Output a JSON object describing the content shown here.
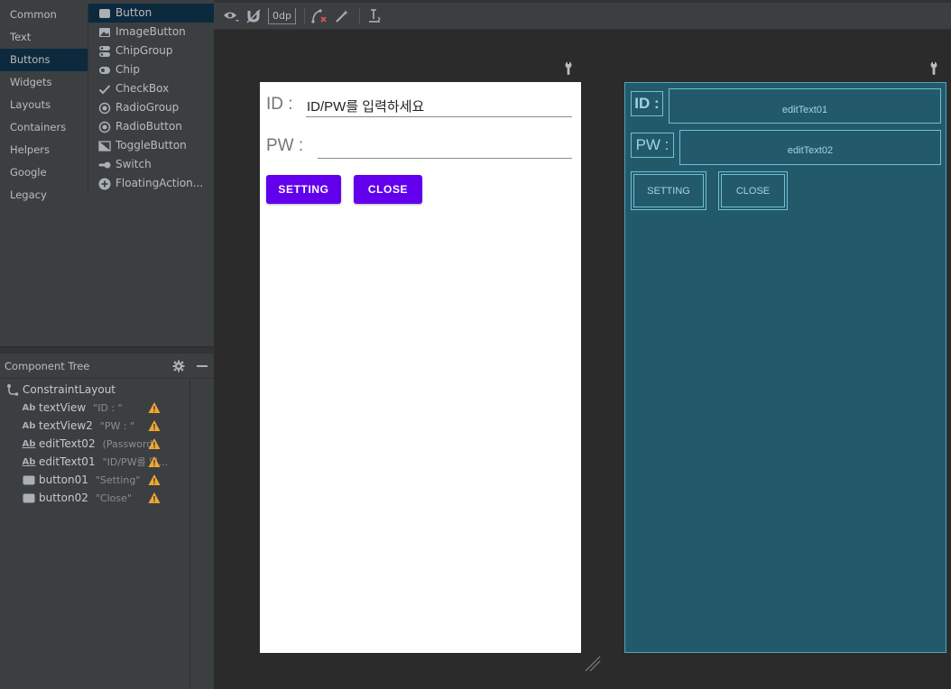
{
  "palette": {
    "categories": [
      "Common",
      "Text",
      "Buttons",
      "Widgets",
      "Layouts",
      "Containers",
      "Helpers",
      "Google",
      "Legacy"
    ],
    "selected_category": "Buttons",
    "items": [
      {
        "label": "Button",
        "icon": "button-icon"
      },
      {
        "label": "ImageButton",
        "icon": "image-button-icon"
      },
      {
        "label": "ChipGroup",
        "icon": "chip-group-icon"
      },
      {
        "label": "Chip",
        "icon": "chip-icon"
      },
      {
        "label": "CheckBox",
        "icon": "checkbox-icon"
      },
      {
        "label": "RadioGroup",
        "icon": "radio-group-icon"
      },
      {
        "label": "RadioButton",
        "icon": "radio-button-icon"
      },
      {
        "label": "ToggleButton",
        "icon": "toggle-button-icon"
      },
      {
        "label": "Switch",
        "icon": "switch-icon"
      },
      {
        "label": "FloatingAction...",
        "icon": "fab-icon"
      }
    ]
  },
  "component_tree": {
    "title": "Component Tree",
    "root": "ConstraintLayout",
    "items": [
      {
        "icon": "Ab",
        "name": "textView",
        "desc": "\"ID : \""
      },
      {
        "icon": "Ab",
        "name": "textView2",
        "desc": "\"PW : \""
      },
      {
        "icon": "Ab_",
        "name": "editText02",
        "desc": "(Password)"
      },
      {
        "icon": "Ab_",
        "name": "editText01",
        "desc": "\"ID/PW를 입력..."
      },
      {
        "icon": "btn",
        "name": "button01",
        "desc": "\"Setting\""
      },
      {
        "icon": "btn",
        "name": "button02",
        "desc": "\"Close\""
      }
    ]
  },
  "toolbar": {
    "margin_value": "0dp"
  },
  "design": {
    "id_label": "ID :",
    "id_value": "ID/PW를 입력하세요",
    "pw_label": "PW :",
    "pw_value": "",
    "setting_label": "SETTING",
    "close_label": "CLOSE"
  },
  "blueprint": {
    "id_label": "ID :",
    "pw_label": "PW :",
    "edit1": "editText01",
    "edit2": "editText02",
    "setting": "SETTING",
    "close": "CLOSE"
  },
  "colors": {
    "accent": "#6200ee",
    "blueprint_bg": "#235a6b",
    "warning": "#f0a732"
  }
}
